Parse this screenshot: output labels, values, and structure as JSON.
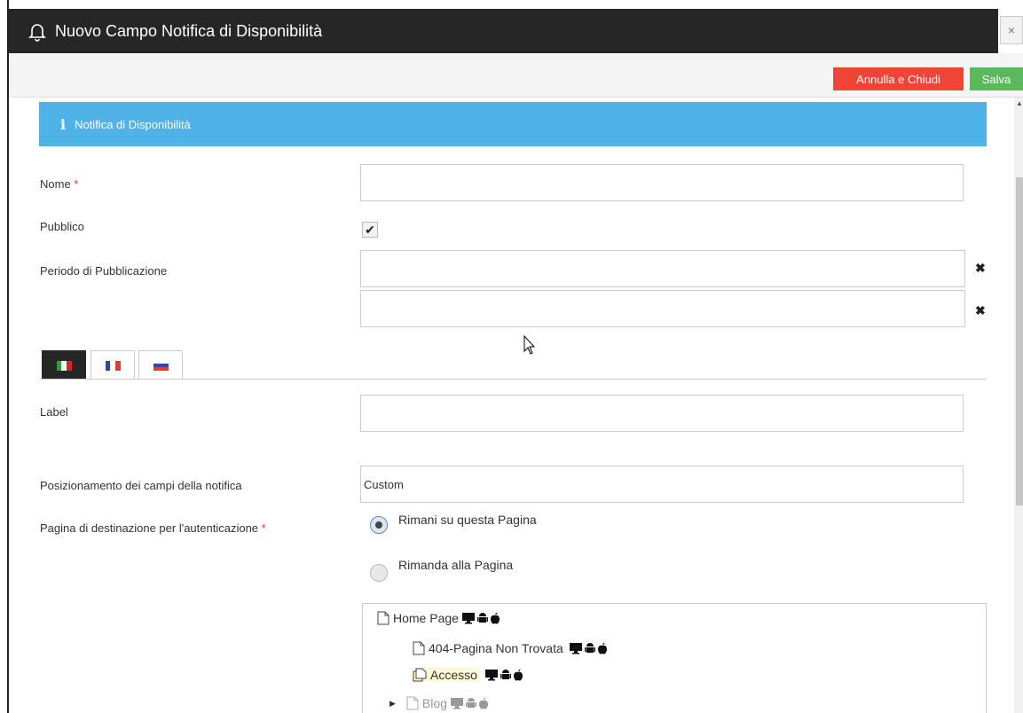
{
  "window": {
    "title": "Nuovo Campo Notifica di Disponibilità",
    "close_glyph": "×"
  },
  "toolbar": {
    "cancel_label": "Annulla e Chiudi",
    "save_label": "Salva",
    "cancel_color": "#f04437",
    "save_color": "#5cb85c"
  },
  "section": {
    "title": "Notifica di Disponibilità",
    "info_glyph": "i",
    "color": "#4fb3e8"
  },
  "form": {
    "nome": {
      "label": "Nome",
      "required_mark": "*",
      "value": ""
    },
    "pubblico": {
      "label": "Pubblico",
      "checked": true,
      "check_glyph": "✔"
    },
    "periodo": {
      "label": "Periodo di Pubblicazione",
      "start_value": "",
      "end_value": "",
      "clear_glyph": "✖"
    },
    "languages": [
      {
        "code": "it",
        "active": true
      },
      {
        "code": "fr",
        "active": false
      },
      {
        "code": "sk",
        "active": false
      }
    ],
    "label_field": {
      "label": "Label",
      "value": ""
    },
    "posizionamento": {
      "label": "Posizionamento dei campi della notifica",
      "value": "Custom"
    },
    "destinazione": {
      "label": "Pagina di destinazione per l'autenticazione",
      "required_mark": "*",
      "options": [
        {
          "label": "Rimani su questa Pagina",
          "checked": true
        },
        {
          "label": "Rimanda alla Pagina",
          "checked": false
        }
      ]
    }
  },
  "tree": {
    "nodes": [
      {
        "label": "Home Page",
        "icons": [
          "desktop-icon",
          "android-icon",
          "apple-icon"
        ]
      },
      {
        "label": "404-Pagina Non Trovata",
        "icons": [
          "desktop-icon",
          "android-icon",
          "apple-icon"
        ]
      },
      {
        "label": "Accesso",
        "highlighted": true,
        "icons": [
          "desktop-icon",
          "android-icon",
          "apple-icon"
        ]
      },
      {
        "label": "Blog",
        "muted": true,
        "collapsed": true,
        "icons": [
          "desktop-icon",
          "android-icon",
          "apple-icon"
        ]
      }
    ]
  }
}
